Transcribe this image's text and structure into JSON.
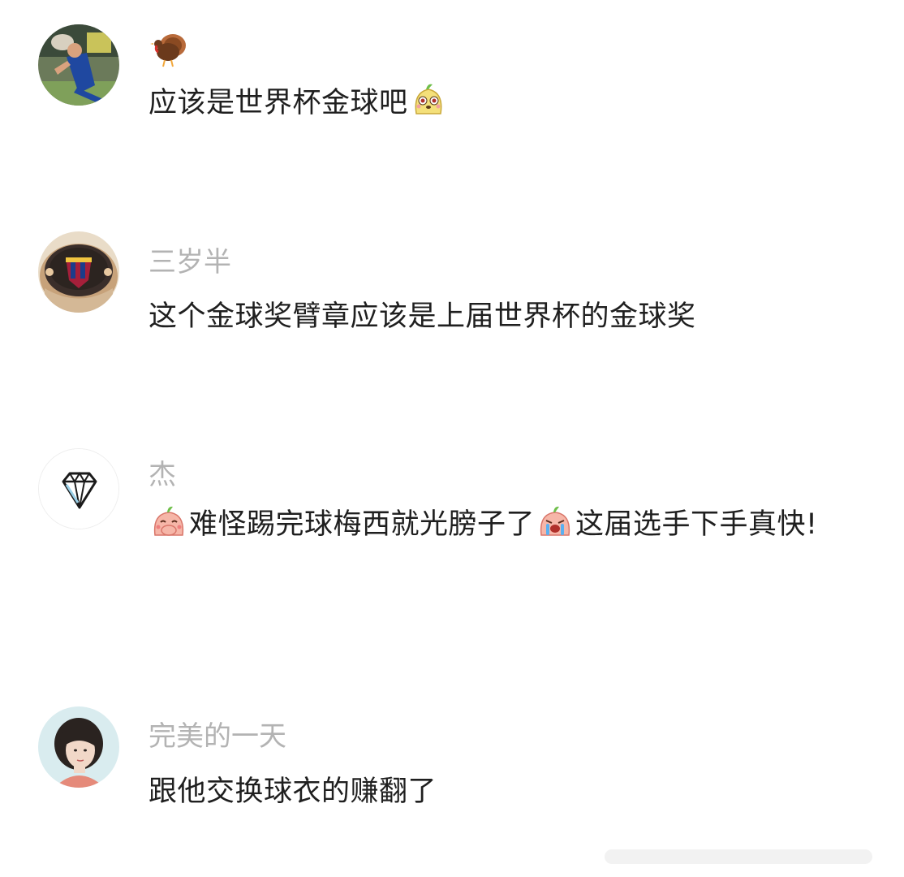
{
  "comments": [
    {
      "user": "",
      "user_icon": "turkey-icon",
      "text_before": "应该是世界杯金球吧",
      "emoji_after": "yellow-dog-emoji"
    },
    {
      "user": "三岁半",
      "text": "这个金球奖臂章应该是上届世界杯的金球奖"
    },
    {
      "user": "杰",
      "emoji_start": "covering-mouth-emoji",
      "text_part1": "难怪踢完球梅西就光膀子了",
      "emoji_mid": "crying-emoji",
      "text_part2": "这届选手下手真快!"
    },
    {
      "user": "完美的一天",
      "text": "跟他交换球衣的赚翻了"
    }
  ],
  "colors": {
    "username": "#b3b3b3",
    "text": "#1f1f1f",
    "background": "#ffffff"
  }
}
